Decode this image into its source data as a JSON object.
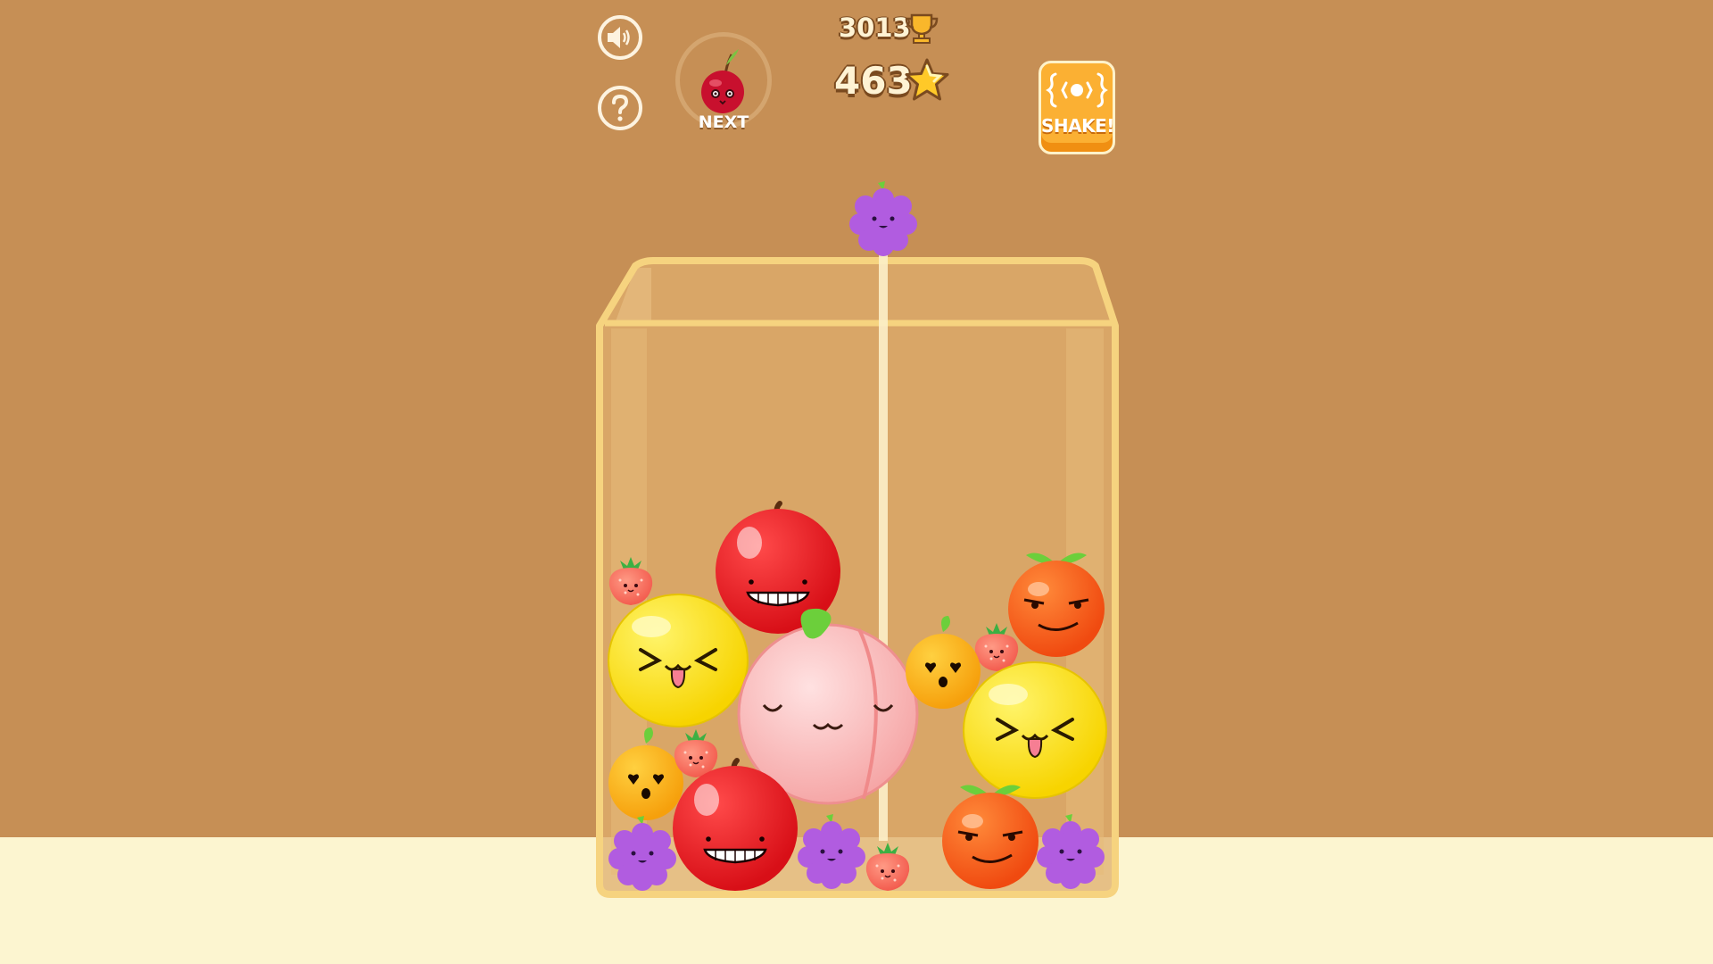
{
  "hud": {
    "best_score": "3013",
    "score": "463",
    "next_label": "NEXT",
    "shake_label": "SHAKE!",
    "sound_icon": "speaker-icon",
    "help_icon": "question-mark-icon",
    "trophy_icon": "trophy-icon",
    "star_icon": "star-icon",
    "shake_icon": "shake-icon",
    "next_fruit": "cherry"
  },
  "dropper": {
    "fruit": "grape"
  },
  "jar_fruits": [
    "strawberry",
    "lemon",
    "apple",
    "peach",
    "orange-citrus",
    "strawberry",
    "tangerine",
    "lemon",
    "tangerine",
    "strawberry",
    "apple",
    "grape",
    "grape",
    "strawberry",
    "orange-citrus",
    "grape"
  ],
  "colors": {
    "background": "#c68f55",
    "floor": "#fcf5d0",
    "jar_outline": "#f6d37f",
    "shake_button": "#fbb033"
  }
}
